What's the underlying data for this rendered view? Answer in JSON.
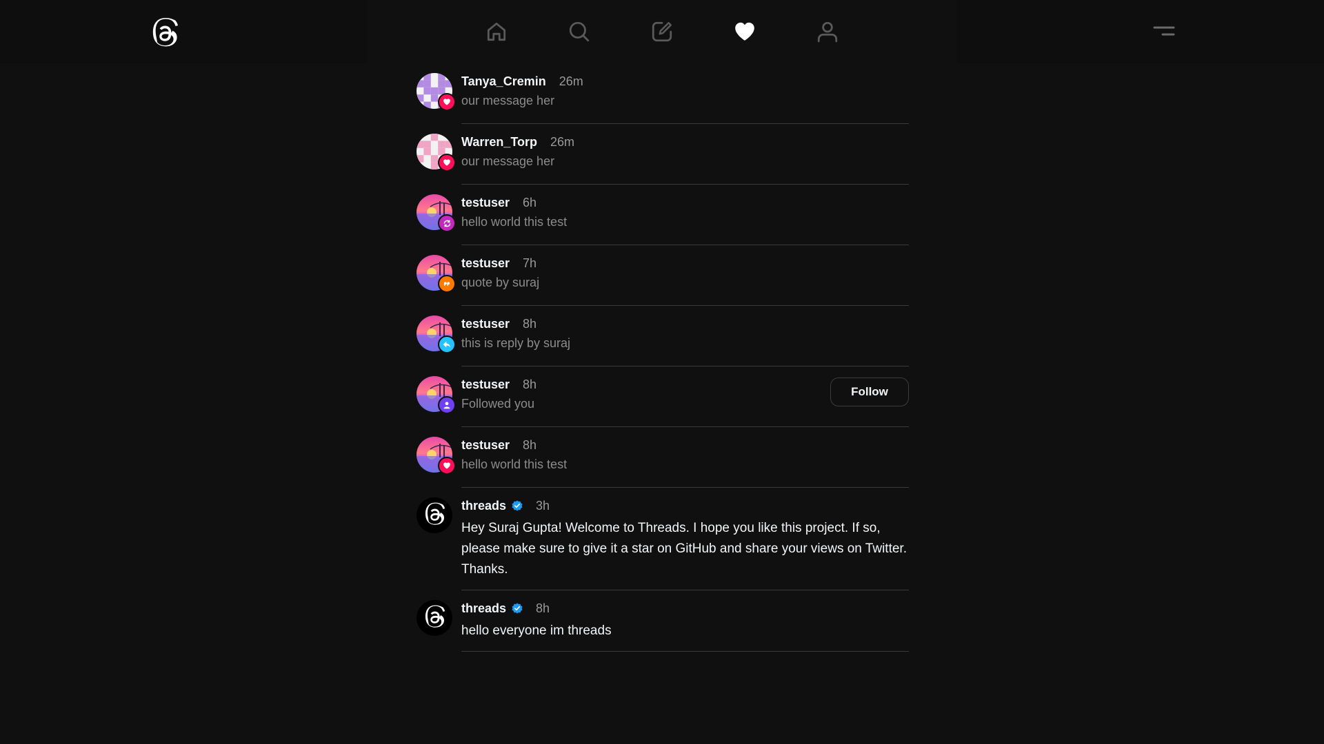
{
  "nav": {
    "items": [
      "home-icon",
      "search-icon",
      "compose-icon",
      "heart-icon",
      "profile-icon"
    ],
    "active": "heart-icon",
    "progress": 0.16
  },
  "colors": {
    "like": "#ff0f5a",
    "repost": "#c329bf",
    "quote": "#fe7900",
    "reply": "#24c3ff",
    "follow": "#6e3ff3",
    "verified": "#1d9bf0"
  },
  "activity": [
    {
      "username": "Tanya_Cremin",
      "time": "26m",
      "text": "our message her",
      "badge": "heart-icon",
      "avatar": "pixel-purple"
    },
    {
      "username": "Warren_Torp",
      "time": "26m",
      "text": "our message her",
      "badge": "heart-icon",
      "avatar": "pixel-pink"
    },
    {
      "username": "testuser",
      "time": "6h",
      "text": "hello world this test",
      "badge": "repost-icon",
      "avatar": "sunset"
    },
    {
      "username": "testuser",
      "time": "7h",
      "text": "quote by suraj",
      "badge": "quote-icon",
      "avatar": "sunset"
    },
    {
      "username": "testuser",
      "time": "8h",
      "text": "this is reply by suraj",
      "badge": "reply-icon",
      "avatar": "sunset"
    },
    {
      "username": "testuser",
      "time": "8h",
      "text": "Followed you",
      "badge": "person-icon",
      "avatar": "sunset",
      "button": "Follow"
    },
    {
      "username": "testuser",
      "time": "8h",
      "text": "hello world this test",
      "badge": "heart-icon",
      "avatar": "sunset"
    },
    {
      "username": "threads",
      "verified": true,
      "time": "3h",
      "text": "Hey Suraj Gupta! Welcome to Threads. I hope you like this project. If so, please make sure to give it a star on GitHub and share your views on Twitter. Thanks.",
      "avatar": "threads-logo"
    },
    {
      "username": "threads",
      "verified": true,
      "time": "8h",
      "text": "hello everyone im threads",
      "avatar": "threads-logo"
    }
  ]
}
